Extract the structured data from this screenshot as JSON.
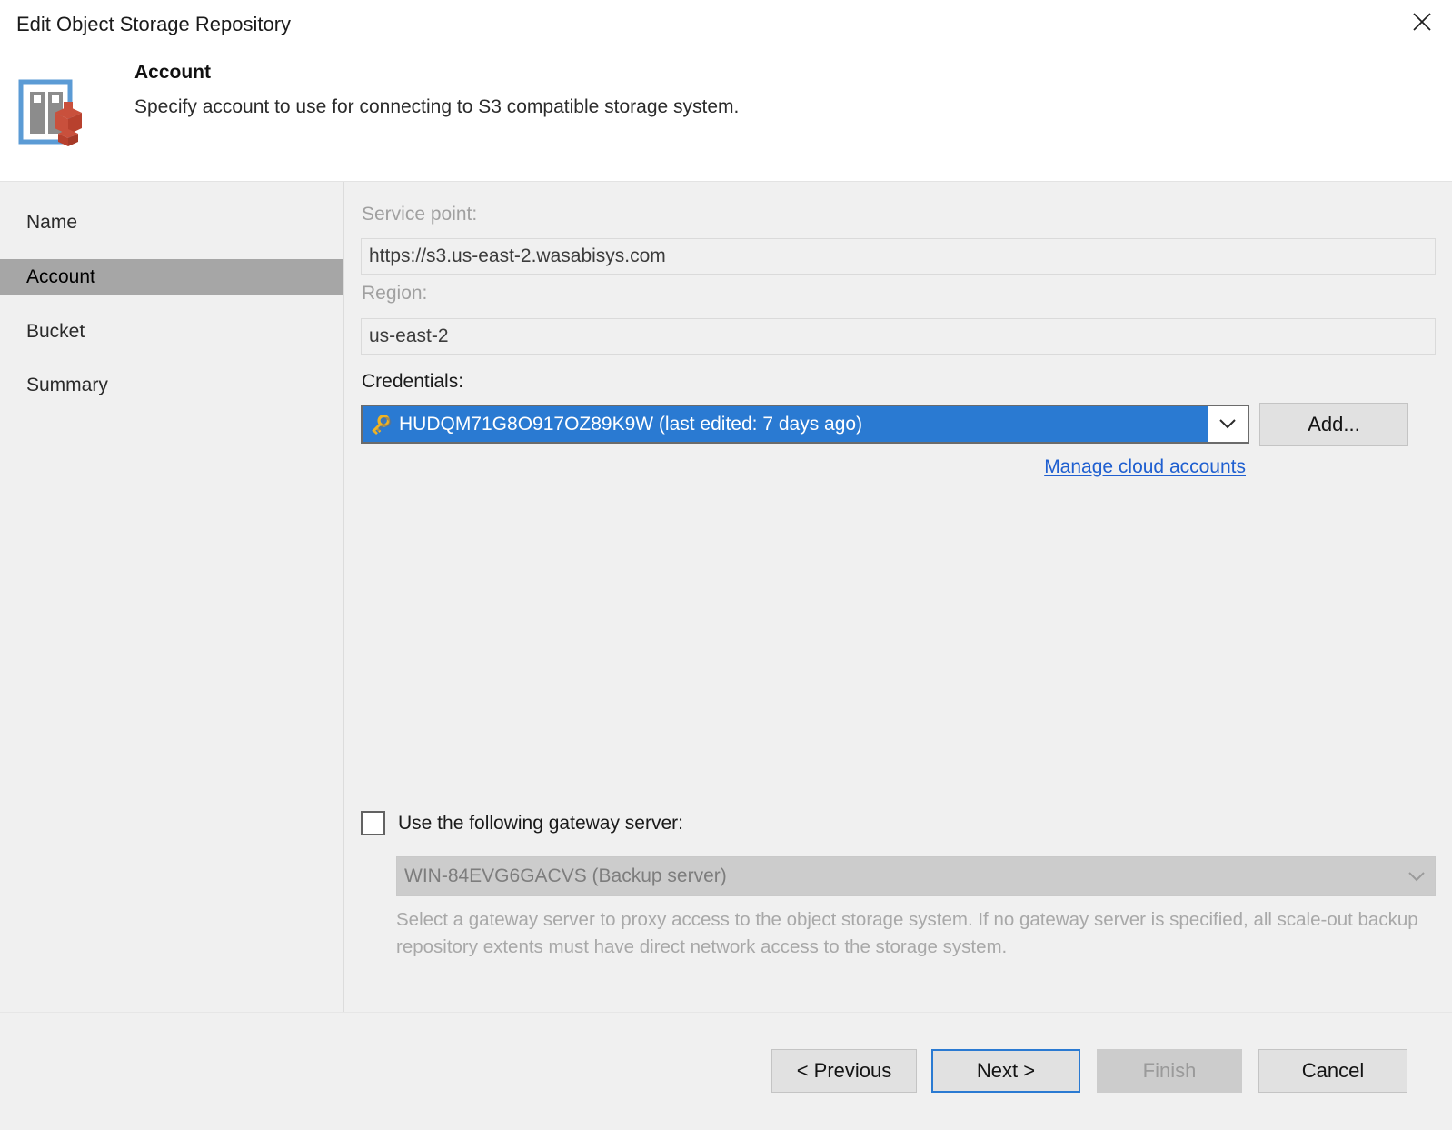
{
  "window": {
    "title": "Edit Object Storage Repository",
    "close_icon": "close-icon"
  },
  "header": {
    "icon": "object-storage-repository-icon",
    "title": "Account",
    "subtitle": "Specify account to use for connecting to S3 compatible storage system."
  },
  "sidebar": {
    "items": [
      {
        "label": "Name",
        "active": false
      },
      {
        "label": "Account",
        "active": true
      },
      {
        "label": "Bucket",
        "active": false
      },
      {
        "label": "Summary",
        "active": false
      }
    ]
  },
  "form": {
    "service_point": {
      "label": "Service point:",
      "value": "https://s3.us-east-2.wasabisys.com",
      "disabled": true
    },
    "region": {
      "label": "Region:",
      "value": "us-east-2",
      "disabled": true
    },
    "credentials": {
      "label": "Credentials:",
      "selected": "HUDQM71G8O917OZ89K9W (last edited: 7 days ago)",
      "icon": "key-icon",
      "arrow_icon": "chevron-down-icon"
    },
    "add_button": "Add...",
    "manage_link": "Manage cloud accounts",
    "gateway": {
      "checkbox_label": "Use the following gateway server:",
      "checked": false,
      "server_value": "WIN-84EVG6GACVS (Backup server)",
      "server_disabled": true,
      "arrow_icon": "chevron-down-icon",
      "hint": "Select a gateway server to proxy access to the object storage system. If no gateway server is specified, all scale-out backup repository extents must have direct network access to the storage system."
    }
  },
  "footer": {
    "previous": "< Previous",
    "next": "Next >",
    "finish": "Finish",
    "cancel": "Cancel"
  },
  "colors": {
    "accent": "#2a7ad2",
    "link": "#1f5fd0",
    "sidebar_active_bg": "#a6a6a6",
    "panel_bg": "#f0f0f0",
    "icon_red": "#c9503c",
    "icon_blue": "#5b9bd5",
    "icon_gray": "#8c8c8c",
    "key_gold": "#f0b323"
  }
}
